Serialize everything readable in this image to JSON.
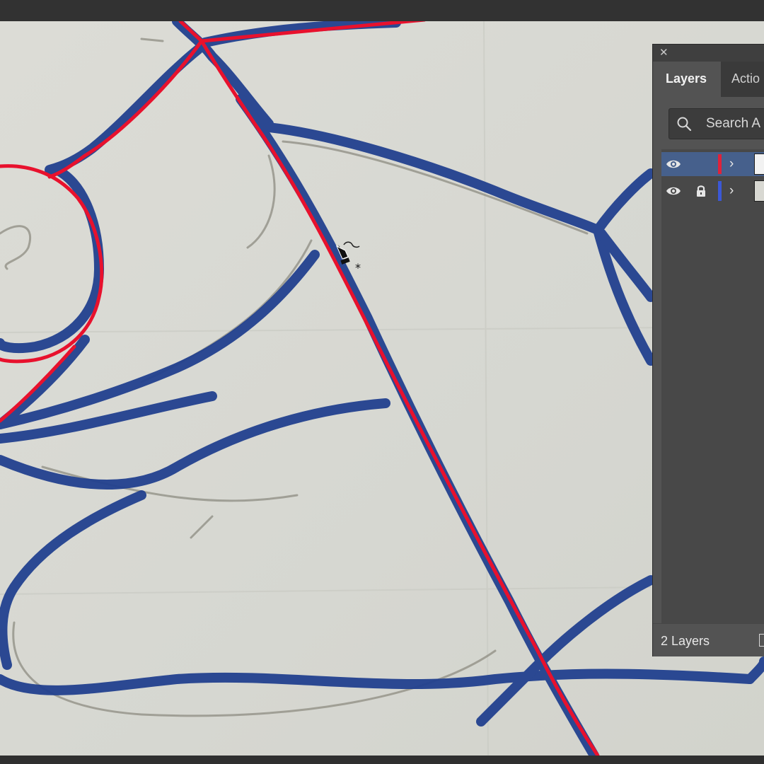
{
  "panel": {
    "close_icon": "close-icon",
    "tabs": [
      {
        "label": "Layers"
      },
      {
        "label": "Actio"
      }
    ],
    "search": {
      "placeholder": "Search A"
    },
    "layers": [
      {
        "color": "#e0223a",
        "visible": true,
        "locked": false,
        "selected": true
      },
      {
        "color": "#3b58d6",
        "visible": true,
        "locked": true,
        "selected": false
      }
    ],
    "layer_count": "2 Layers"
  },
  "colors": {
    "ink_blue": "#22418f",
    "vector_red": "#e8112d",
    "paper": "#d9d9d3",
    "selection": "#46608c"
  },
  "cursor": {
    "icon": "pen-tool-cursor-icon"
  }
}
